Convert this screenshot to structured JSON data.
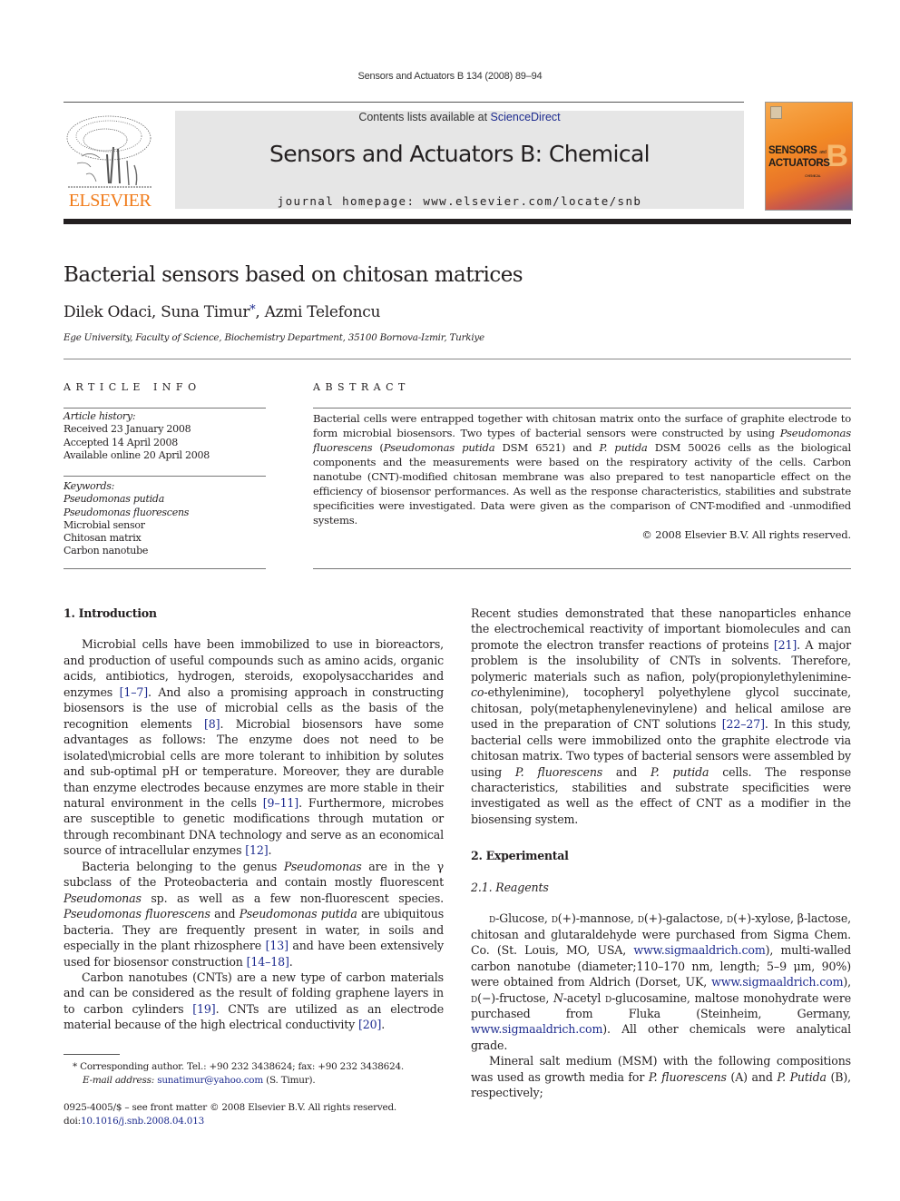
{
  "running_head": "Sensors and Actuators B 134 (2008) 89–94",
  "masthead": {
    "contents_prefix": "Contents lists available at ",
    "contents_link": "ScienceDirect",
    "journal_title": "Sensors and Actuators B: Chemical",
    "homepage": "journal homepage: www.elsevier.com/locate/snb",
    "publisher_logo_text": "ELSEVIER",
    "cover_title_line1": "SENSORS",
    "cover_title_and": "and",
    "cover_title_line2": "ACTUATORS",
    "cover_letter": "B",
    "cover_subtitle": "CHEMICAL",
    "brand_color": "#f07b1a",
    "link_color": "#1d2b8f"
  },
  "article": {
    "title": "Bacterial sensors based on chitosan matrices",
    "authors": [
      {
        "name": "Dilek Odaci",
        "sep": ", "
      },
      {
        "name": "Suna Timur",
        "mark": "*",
        "sep": ", "
      },
      {
        "name": "Azmi Telefoncu",
        "sep": ""
      }
    ],
    "affiliation": "Ege University, Faculty of Science, Biochemistry Department, 35100 Bornova-Izmir, Turkiye"
  },
  "article_info": {
    "heading": "ARTICLE INFO",
    "history_label": "Article history:",
    "history": [
      "Received 23 January 2008",
      "Accepted 14 April 2008",
      "Available online 20 April 2008"
    ],
    "keywords_label": "Keywords:",
    "keywords": [
      {
        "text": "Pseudomonas putida",
        "italic": true
      },
      {
        "text": "Pseudomonas fluorescens",
        "italic": true
      },
      {
        "text": "Microbial sensor",
        "italic": false
      },
      {
        "text": "Chitosan matrix",
        "italic": false
      },
      {
        "text": "Carbon nanotube",
        "italic": false
      }
    ]
  },
  "abstract": {
    "heading": "ABSTRACT",
    "segments": [
      {
        "t": "Bacterial cells were entrapped together with chitosan matrix onto the surface of graphite electrode to form microbial biosensors. Two types of bacterial sensors were constructed by using "
      },
      {
        "t": "Pseudomonas fluorescens",
        "i": true
      },
      {
        "t": " ("
      },
      {
        "t": "Pseudomonas putida",
        "i": true
      },
      {
        "t": " DSM 6521) and "
      },
      {
        "t": "P. putida",
        "i": true
      },
      {
        "t": " DSM 50026 cells as the biological components and the measurements were based on the respiratory activity of the cells. Carbon nanotube (CNT)-modified chitosan membrane was also prepared to test nanoparticle effect on the efficiency of biosensor performances. As well as the response characteristics, stabilities and substrate specificities were investigated. Data were given as the comparison of CNT-modified and -unmodified systems."
      }
    ],
    "copyright": "© 2008 Elsevier B.V. All rights reserved."
  },
  "body": {
    "left": [
      {
        "type": "section",
        "text": "1.  Introduction"
      },
      {
        "type": "p",
        "segments": [
          {
            "t": "Microbial cells have been immobilized to use in bioreactors, and production of useful compounds such as amino acids, organic acids, antibiotics, hydrogen, steroids, exopolysaccharides and enzymes "
          },
          {
            "t": "[1–7]",
            "ref": true
          },
          {
            "t": ". And also a promising approach in constructing biosensors is the use of microbial cells as the basis of the recognition elements "
          },
          {
            "t": "[8]",
            "ref": true
          },
          {
            "t": ". Microbial biosensors have some advantages as follows: The enzyme does not need to be isolated\\microbial cells are more tolerant to inhibition by solutes and sub-optimal pH or temperature. Moreover, they are durable than enzyme electrodes because enzymes are more stable in their natural environment in the cells "
          },
          {
            "t": "[9–11]",
            "ref": true
          },
          {
            "t": ". Furthermore, microbes are susceptible to genetic modifications through mutation or through recombinant DNA technology and serve as an economical source of intracellular enzymes "
          },
          {
            "t": "[12]",
            "ref": true
          },
          {
            "t": "."
          }
        ]
      },
      {
        "type": "p",
        "segments": [
          {
            "t": "Bacteria belonging to the genus "
          },
          {
            "t": "Pseudomonas",
            "i": true
          },
          {
            "t": " are in the γ subclass of the Proteobacteria and contain mostly fluorescent "
          },
          {
            "t": "Pseudomonas",
            "i": true
          },
          {
            "t": " sp. as well as a few non-fluorescent species. "
          },
          {
            "t": "Pseudomonas fluorescens",
            "i": true
          },
          {
            "t": " and "
          },
          {
            "t": "Pseudomonas putida",
            "i": true
          },
          {
            "t": " are ubiquitous bacteria. They are frequently present in water, in soils and especially in the plant rhizosphere "
          },
          {
            "t": "[13]",
            "ref": true
          },
          {
            "t": " and have been extensively used for biosensor construction "
          },
          {
            "t": "[14–18]",
            "ref": true
          },
          {
            "t": "."
          }
        ]
      },
      {
        "type": "p",
        "segments": [
          {
            "t": "Carbon nanotubes (CNTs) are a new type of carbon materials and can be considered as the result of folding graphene layers in to carbon cylinders "
          },
          {
            "t": "[19]",
            "ref": true
          },
          {
            "t": ". CNTs are utilized as an electrode material because of the high electrical conductivity "
          },
          {
            "t": "[20]",
            "ref": true
          },
          {
            "t": "."
          }
        ]
      }
    ],
    "right": [
      {
        "type": "p",
        "noindent": true,
        "segments": [
          {
            "t": "Recent studies demonstrated that these nanoparticles enhance the electrochemical reactivity of important biomolecules and can promote the electron transfer reactions of proteins "
          },
          {
            "t": "[21]",
            "ref": true
          },
          {
            "t": ". A major problem is the insolubility of CNTs in solvents. Therefore, polymeric materials such as nafion, poly(propionylethylenimine-"
          },
          {
            "t": "co",
            "i": true
          },
          {
            "t": "-ethylenimine), tocopheryl polyethylene glycol succinate, chitosan, poly(metaphenylenevinylene) and helical amilose are used in the preparation of CNT solutions "
          },
          {
            "t": "[22–27]",
            "ref": true
          },
          {
            "t": ". In this study, bacterial cells were immobilized onto the graphite electrode via chitosan matrix. Two types of bacterial sensors were assembled by using "
          },
          {
            "t": "P. fluorescens",
            "i": true
          },
          {
            "t": " and "
          },
          {
            "t": "P. putida",
            "i": true
          },
          {
            "t": " cells. The response characteristics, stabilities and substrate specificities were investigated as well as the effect of CNT as a modifier in the biosensing system."
          }
        ]
      },
      {
        "type": "section",
        "text": "2.  Experimental"
      },
      {
        "type": "subsection",
        "text": "2.1.  Reagents"
      },
      {
        "type": "p",
        "segments": [
          {
            "t": "d",
            "sc": true
          },
          {
            "t": "-Glucose, "
          },
          {
            "t": "d",
            "sc": true
          },
          {
            "t": "(+)-mannose, "
          },
          {
            "t": "d",
            "sc": true
          },
          {
            "t": "(+)-galactose, "
          },
          {
            "t": "d",
            "sc": true
          },
          {
            "t": "(+)-xylose, β-lactose, chitosan and glutaraldehyde were purchased from Sigma Chem. Co. (St. Louis, MO, USA, "
          },
          {
            "t": "www.sigmaaldrich.com",
            "ref": true
          },
          {
            "t": "), multi-walled carbon nanotube (diameter;110–170 nm, length; 5–9 μm, 90%) were obtained from Aldrich (Dorset, UK, "
          },
          {
            "t": "www.sigmaaldrich.com",
            "ref": true
          },
          {
            "t": "), "
          },
          {
            "t": "d",
            "sc": true
          },
          {
            "t": "(−)-fructose, "
          },
          {
            "t": "N",
            "i": true
          },
          {
            "t": "-acetyl "
          },
          {
            "t": "d",
            "sc": true
          },
          {
            "t": "-glucosamine, maltose monohydrate were purchased from Fluka (Steinheim, Germany, "
          },
          {
            "t": "www.sigmaaldrich.com",
            "ref": true
          },
          {
            "t": "). All other chemicals were analytical grade."
          }
        ]
      },
      {
        "type": "p",
        "segments": [
          {
            "t": "Mineral salt medium (MSM) with the following compositions was used as growth media for "
          },
          {
            "t": "P. fluorescens",
            "i": true
          },
          {
            "t": " (A) and "
          },
          {
            "t": "P. Putida",
            "i": true
          },
          {
            "t": " (B), respectively;"
          }
        ]
      }
    ]
  },
  "footnote": {
    "mark": "*",
    "text": "Corresponding author. Tel.: +90 232 3438624; fax: +90 232 3438624.",
    "email_label": "E-mail address:",
    "email": "sunatimur@yahoo.com",
    "email_suffix": " (S. Timur)."
  },
  "footer": {
    "issn_line": "0925-4005/$ – see front matter © 2008 Elsevier B.V. All rights reserved.",
    "doi_label": "doi:",
    "doi": "10.1016/j.snb.2008.04.013"
  }
}
